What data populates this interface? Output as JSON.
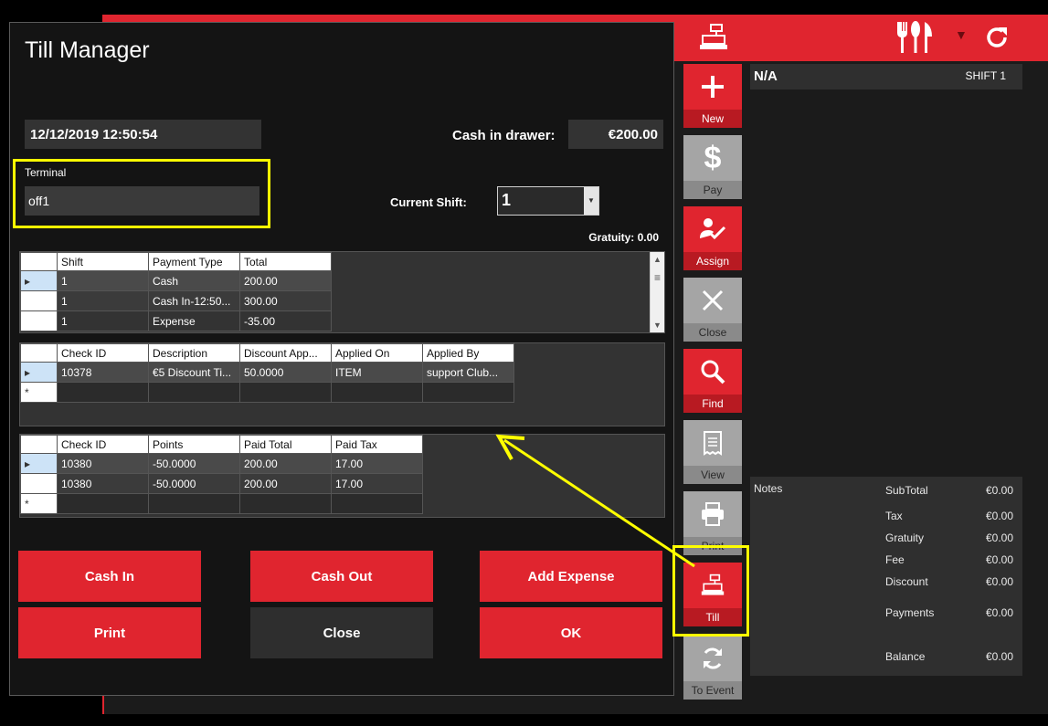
{
  "pos": {
    "colors": {
      "brand": "#e0252f",
      "highlight": "#ffff00"
    },
    "top_icons": [
      "cash-register-icon",
      "cutlery-icon",
      "caret-down-icon",
      "refresh-icon"
    ],
    "side_buttons": [
      {
        "label": "New",
        "icon": "plus-icon"
      },
      {
        "label": "Pay",
        "icon": "dollar-icon"
      },
      {
        "label": "Assign",
        "icon": "assign-user-icon"
      },
      {
        "label": "Close",
        "icon": "close-icon"
      },
      {
        "label": "Find",
        "icon": "search-icon"
      },
      {
        "label": "View",
        "icon": "receipt-icon"
      },
      {
        "label": "Print",
        "icon": "printer-icon"
      },
      {
        "label": "Till",
        "icon": "cash-register-icon"
      },
      {
        "label": "To Event",
        "icon": "sync-icon"
      }
    ],
    "order": {
      "name": "N/A",
      "shift": "SHIFT 1"
    },
    "summary": {
      "notes_label": "Notes",
      "rows": [
        {
          "label": "SubTotal",
          "value": "€0.00"
        },
        {
          "label": "Tax",
          "value": "€0.00"
        },
        {
          "label": "Gratuity",
          "value": "€0.00"
        },
        {
          "label": "Fee",
          "value": "€0.00"
        },
        {
          "label": "Discount",
          "value": "€0.00"
        },
        {
          "label": "Payments",
          "value": "€0.00"
        },
        {
          "label": "Balance",
          "value": "€0.00"
        }
      ]
    }
  },
  "dialog": {
    "title": "Till Manager",
    "datetime": "12/12/2019 12:50:54",
    "cash_label": "Cash in drawer:",
    "cash_value": "€200.00",
    "terminal_label": "Terminal",
    "terminal_value": "off1",
    "shift_label": "Current Shift:",
    "shift_value": "1",
    "gratuity": "Gratuity: 0.00",
    "payments_grid": {
      "headers": [
        "Shift",
        "Payment Type",
        "Total"
      ],
      "rows": [
        [
          "1",
          "Cash",
          "200.00"
        ],
        [
          "1",
          "Cash In-12:50...",
          "300.00"
        ],
        [
          "1",
          "Expense",
          "-35.00"
        ]
      ]
    },
    "discounts_grid": {
      "headers": [
        "Check ID",
        "Description",
        "Discount App...",
        "Applied On",
        "Applied By"
      ],
      "rows": [
        [
          "10378",
          "€5 Discount Ti...",
          "50.0000",
          "ITEM",
          "support Club..."
        ]
      ],
      "new_row_marker": "*"
    },
    "points_grid": {
      "headers": [
        "Check ID",
        "Points",
        "Paid Total",
        "Paid Tax"
      ],
      "rows": [
        [
          "10380",
          "-50.0000",
          "200.00",
          "17.00"
        ],
        [
          "10380",
          "-50.0000",
          "200.00",
          "17.00"
        ]
      ],
      "new_row_marker": "*"
    },
    "buttons": {
      "cash_in": "Cash In",
      "cash_out": "Cash Out",
      "add_expense": "Add Expense",
      "print": "Print",
      "close": "Close",
      "ok": "OK"
    }
  }
}
